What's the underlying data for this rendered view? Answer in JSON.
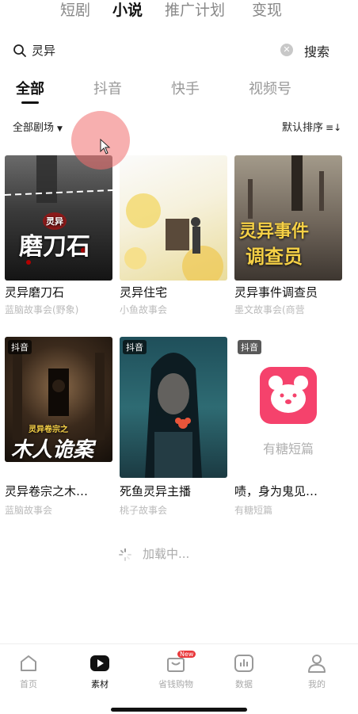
{
  "top_tabs": [
    {
      "label": "短剧"
    },
    {
      "label": "小说"
    },
    {
      "label": "推广计划"
    },
    {
      "label": "变现"
    }
  ],
  "search": {
    "value": "灵异",
    "button_label": "搜索"
  },
  "category_tabs": [
    {
      "label": "全部"
    },
    {
      "label": "抖音"
    },
    {
      "label": "快手"
    },
    {
      "label": "视频号"
    }
  ],
  "filter": {
    "label": "全部剧场"
  },
  "sort": {
    "label": "默认排序"
  },
  "cards": [
    {
      "title": "灵异磨刀石",
      "subtitle": "蓝脑故事会(野象)",
      "cover_text": "磨刀石",
      "cover_sub": "灵异"
    },
    {
      "title": "灵异住宅",
      "subtitle": "小鱼故事会"
    },
    {
      "title": "灵异事件调查员",
      "subtitle": "墨文故事会(商营",
      "cover_text": "灵异事件",
      "cover_text2": "调查员"
    },
    {
      "title": "灵异卷宗之木…",
      "subtitle": "蓝脑故事会",
      "badge": "抖音",
      "cover_text": "木人诡案",
      "cover_sub": "灵异卷宗之"
    },
    {
      "title": "死鱼灵异主播",
      "subtitle": "桃子故事会",
      "badge": "抖音"
    },
    {
      "title": "啧，身为鬼见…",
      "subtitle": "有糖短篇",
      "badge": "抖音",
      "cover_text": "有糖短篇"
    }
  ],
  "loading": {
    "label": "加载中..."
  },
  "bottom_nav": [
    {
      "label": "首页"
    },
    {
      "label": "素材"
    },
    {
      "label": "省钱购物",
      "badge": "New"
    },
    {
      "label": "数据"
    },
    {
      "label": "我的"
    }
  ]
}
